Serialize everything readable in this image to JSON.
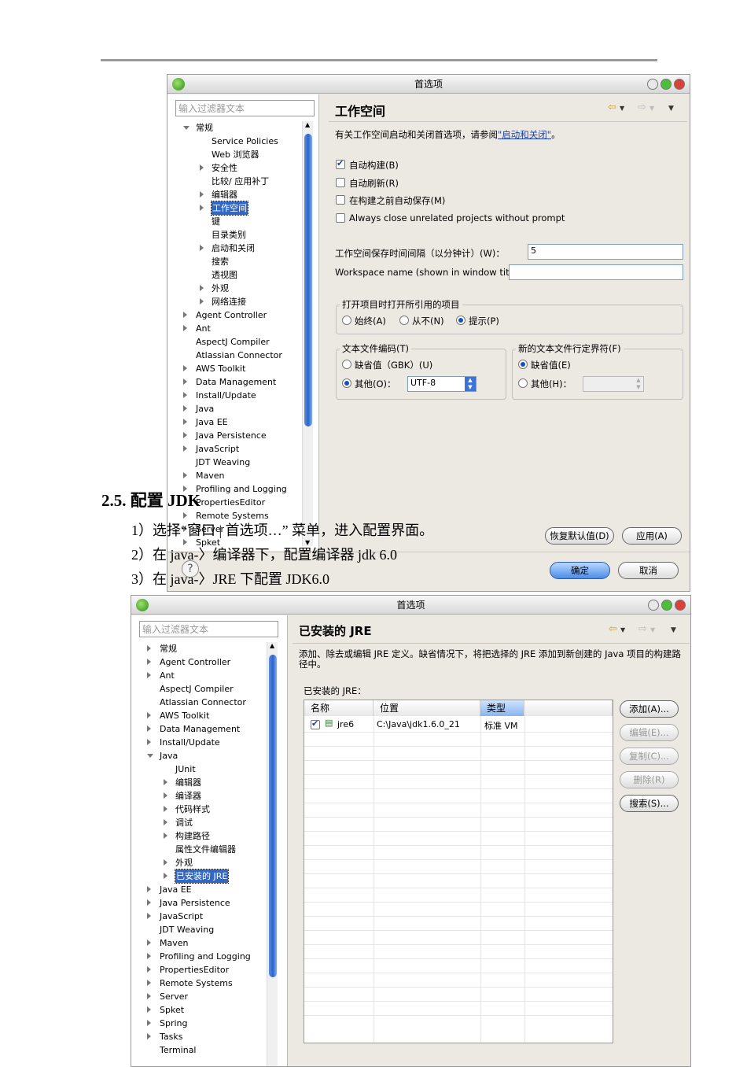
{
  "dialog1": {
    "title": "首选项",
    "filter_placeholder": "输入过滤器文本",
    "tree": [
      {
        "label": "常规",
        "depth": 0,
        "arrow": "open"
      },
      {
        "label": "Service Policies",
        "depth": 1,
        "arrow": "none"
      },
      {
        "label": "Web 浏览器",
        "depth": 1,
        "arrow": "none"
      },
      {
        "label": "安全性",
        "depth": 1,
        "arrow": "closed"
      },
      {
        "label": "比较/ 应用补丁",
        "depth": 1,
        "arrow": "none"
      },
      {
        "label": "编辑器",
        "depth": 1,
        "arrow": "closed"
      },
      {
        "label": "工作空间",
        "depth": 1,
        "arrow": "closed",
        "selected": true
      },
      {
        "label": "键",
        "depth": 1,
        "arrow": "none"
      },
      {
        "label": "目录类别",
        "depth": 1,
        "arrow": "none"
      },
      {
        "label": "启动和关闭",
        "depth": 1,
        "arrow": "closed"
      },
      {
        "label": "搜索",
        "depth": 1,
        "arrow": "none"
      },
      {
        "label": "透视图",
        "depth": 1,
        "arrow": "none"
      },
      {
        "label": "外观",
        "depth": 1,
        "arrow": "closed"
      },
      {
        "label": "网络连接",
        "depth": 1,
        "arrow": "closed"
      },
      {
        "label": "Agent Controller",
        "depth": 0,
        "arrow": "closed"
      },
      {
        "label": "Ant",
        "depth": 0,
        "arrow": "closed"
      },
      {
        "label": "AspectJ Compiler",
        "depth": 0,
        "arrow": "none"
      },
      {
        "label": "Atlassian Connector",
        "depth": 0,
        "arrow": "none"
      },
      {
        "label": "AWS Toolkit",
        "depth": 0,
        "arrow": "closed"
      },
      {
        "label": "Data Management",
        "depth": 0,
        "arrow": "closed"
      },
      {
        "label": "Install/Update",
        "depth": 0,
        "arrow": "closed"
      },
      {
        "label": "Java",
        "depth": 0,
        "arrow": "closed"
      },
      {
        "label": "Java EE",
        "depth": 0,
        "arrow": "closed"
      },
      {
        "label": "Java Persistence",
        "depth": 0,
        "arrow": "closed"
      },
      {
        "label": "JavaScript",
        "depth": 0,
        "arrow": "closed"
      },
      {
        "label": "JDT Weaving",
        "depth": 0,
        "arrow": "none"
      },
      {
        "label": "Maven",
        "depth": 0,
        "arrow": "closed"
      },
      {
        "label": "Profiling and Logging",
        "depth": 0,
        "arrow": "closed"
      },
      {
        "label": "PropertiesEditor",
        "depth": 0,
        "arrow": "none"
      },
      {
        "label": "Remote Systems",
        "depth": 0,
        "arrow": "closed"
      },
      {
        "label": "Server",
        "depth": 0,
        "arrow": "closed"
      },
      {
        "label": "Spket",
        "depth": 0,
        "arrow": "closed"
      }
    ],
    "page_title": "工作空间",
    "description": "有关工作空间启动和关闭首选项，请参阅",
    "description_link": "\"启动和关闭\"",
    "description_end": "。",
    "checkboxes": [
      {
        "label": "自动构建(B)",
        "checked": true
      },
      {
        "label": "自动刷新(R)",
        "checked": false
      },
      {
        "label": "在构建之前自动保存(M)",
        "checked": false
      },
      {
        "label": "Always close unrelated projects without prompt",
        "checked": false
      }
    ],
    "save_interval_label": "工作空间保存时间间隔（以分钟计）(W)：",
    "save_interval_value": "5",
    "workspace_name_label": "Workspace name (shown in window title):",
    "workspace_name_value": "",
    "open_ref_group": "打开项目时打开所引用的项目",
    "open_ref_options": [
      "始终(A)",
      "从不(N)",
      "提示(P)"
    ],
    "open_ref_selected": 2,
    "encoding_group": "文本文件编码(T)",
    "encoding_default": "缺省值（GBK）(U)",
    "encoding_other": "其他(O)：",
    "encoding_value": "UTF-8",
    "delim_group": "新的文本文件行定界符(F)",
    "delim_default": "缺省值(E)",
    "delim_other": "其他(H)：",
    "restore_button": "恢复默认值(D)",
    "apply_button": "应用(A)",
    "ok_button": "确定",
    "cancel_button": "取消",
    "help": "?"
  },
  "document": {
    "heading": "2.5. 配置 JDK",
    "steps": [
      "1）选择“窗口 | 首选项…” 菜单，进入配置界面。",
      "2）在 java-〉编译器下，配置编译器 jdk 6.0",
      "3）在 java-〉JRE 下配置 JDK6.0"
    ]
  },
  "dialog2": {
    "title": "首选项",
    "filter_placeholder": "输入过滤器文本",
    "tree": [
      {
        "label": "常规",
        "depth": 0,
        "arrow": "closed"
      },
      {
        "label": "Agent Controller",
        "depth": 0,
        "arrow": "closed"
      },
      {
        "label": "Ant",
        "depth": 0,
        "arrow": "closed"
      },
      {
        "label": "AspectJ Compiler",
        "depth": 0,
        "arrow": "none"
      },
      {
        "label": "Atlassian Connector",
        "depth": 0,
        "arrow": "none"
      },
      {
        "label": "AWS Toolkit",
        "depth": 0,
        "arrow": "closed"
      },
      {
        "label": "Data Management",
        "depth": 0,
        "arrow": "closed"
      },
      {
        "label": "Install/Update",
        "depth": 0,
        "arrow": "closed"
      },
      {
        "label": "Java",
        "depth": 0,
        "arrow": "open"
      },
      {
        "label": "JUnit",
        "depth": 1,
        "arrow": "none"
      },
      {
        "label": "编辑器",
        "depth": 1,
        "arrow": "closed"
      },
      {
        "label": "编译器",
        "depth": 1,
        "arrow": "closed"
      },
      {
        "label": "代码样式",
        "depth": 1,
        "arrow": "closed"
      },
      {
        "label": "调试",
        "depth": 1,
        "arrow": "closed"
      },
      {
        "label": "构建路径",
        "depth": 1,
        "arrow": "closed"
      },
      {
        "label": "属性文件编辑器",
        "depth": 1,
        "arrow": "none"
      },
      {
        "label": "外观",
        "depth": 1,
        "arrow": "closed"
      },
      {
        "label": "已安装的 JRE",
        "depth": 1,
        "arrow": "closed",
        "selected": true
      },
      {
        "label": "Java EE",
        "depth": 0,
        "arrow": "closed"
      },
      {
        "label": "Java Persistence",
        "depth": 0,
        "arrow": "closed"
      },
      {
        "label": "JavaScript",
        "depth": 0,
        "arrow": "closed"
      },
      {
        "label": "JDT Weaving",
        "depth": 0,
        "arrow": "none"
      },
      {
        "label": "Maven",
        "depth": 0,
        "arrow": "closed"
      },
      {
        "label": "Profiling and Logging",
        "depth": 0,
        "arrow": "closed"
      },
      {
        "label": "PropertiesEditor",
        "depth": 0,
        "arrow": "closed"
      },
      {
        "label": "Remote Systems",
        "depth": 0,
        "arrow": "closed"
      },
      {
        "label": "Server",
        "depth": 0,
        "arrow": "closed"
      },
      {
        "label": "Spket",
        "depth": 0,
        "arrow": "closed"
      },
      {
        "label": "Spring",
        "depth": 0,
        "arrow": "closed"
      },
      {
        "label": "Tasks",
        "depth": 0,
        "arrow": "closed"
      },
      {
        "label": "Terminal",
        "depth": 0,
        "arrow": "none"
      }
    ],
    "page_title": "已安装的 JRE",
    "description": "添加、除去或编辑 JRE 定义。缺省情况下，将把选择的 JRE 添加到新创建的 Java 项目的构建路径中。",
    "table_label": "已安装的 JRE：",
    "columns": [
      "名称",
      "位置",
      "类型"
    ],
    "rows": [
      {
        "checked": true,
        "name": "jre6",
        "location": "C:\\Java\\jdk1.6.0_21",
        "type": "标准 VM"
      }
    ],
    "buttons": [
      {
        "label": "添加(A)...",
        "enabled": true
      },
      {
        "label": "编辑(E)...",
        "enabled": false
      },
      {
        "label": "复制(C)...",
        "enabled": false
      },
      {
        "label": "删除(R)",
        "enabled": false
      },
      {
        "label": "搜索(S)...",
        "enabled": true
      }
    ]
  }
}
